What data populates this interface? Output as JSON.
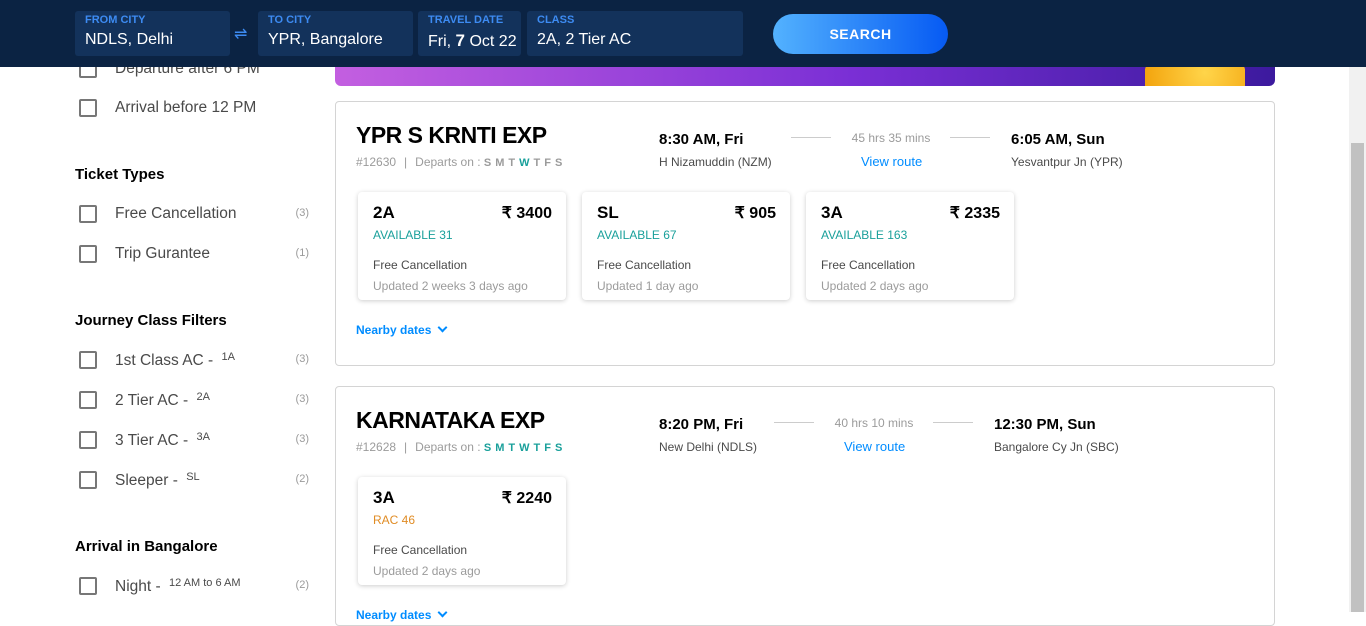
{
  "search": {
    "from": {
      "label": "FROM CITY",
      "value": "NDLS, Delhi"
    },
    "to": {
      "label": "TO CITY",
      "value": "YPR, Bangalore"
    },
    "date": {
      "label": "TRAVEL DATE",
      "prefix": "Fri, ",
      "day": "7",
      "suffix": " Oct 22"
    },
    "class": {
      "label": "CLASS",
      "value": "2A, 2 Tier AC"
    },
    "swap_icon": "⇌",
    "button": "SEARCH"
  },
  "sidebar": {
    "time_filters": [
      {
        "label": "Departure after 6 PM"
      },
      {
        "label": "Arrival before 12 PM"
      }
    ],
    "ticket_types": {
      "title": "Ticket Types",
      "items": [
        {
          "label": "Free Cancellation",
          "count": "(3)"
        },
        {
          "label": "Trip Gurantee",
          "count": "(1)"
        }
      ]
    },
    "journey_class": {
      "title": "Journey Class Filters",
      "items": [
        {
          "label": "1st Class AC - ",
          "sub": "1A",
          "count": "(3)"
        },
        {
          "label": "2 Tier AC - ",
          "sub": "2A",
          "count": "(3)"
        },
        {
          "label": "3 Tier AC - ",
          "sub": "3A",
          "count": "(3)"
        },
        {
          "label": "Sleeper - ",
          "sub": "SL",
          "count": "(2)"
        }
      ]
    },
    "arrival": {
      "title": "Arrival in Bangalore",
      "items": [
        {
          "label": "Night - ",
          "sub": "12 AM to 6 AM",
          "count": "(2)"
        }
      ]
    }
  },
  "trains": [
    {
      "name": "YPR S KRNTI EXP",
      "number": "#12630",
      "departs_label": "Departs on :",
      "days": [
        "S",
        "M",
        "T",
        "W",
        "T",
        "F",
        "S"
      ],
      "days_on": [
        false,
        false,
        false,
        true,
        false,
        false,
        false
      ],
      "dep_time": "8:30 AM, Fri",
      "dep_station": "H Nizamuddin (NZM)",
      "duration": "45 hrs 35 mins",
      "route_link": "View route",
      "arr_time": "6:05 AM, Sun",
      "arr_station": "Yesvantpur Jn (YPR)",
      "fares": [
        {
          "cls": "2A",
          "price": "₹ 3400",
          "avail": "AVAILABLE 31",
          "status": "green",
          "fc": "Free Cancellation",
          "updated": "Updated 2 weeks 3 days ago"
        },
        {
          "cls": "SL",
          "price": "₹ 905",
          "avail": "AVAILABLE 67",
          "status": "green",
          "fc": "Free Cancellation",
          "updated": "Updated 1 day ago"
        },
        {
          "cls": "3A",
          "price": "₹ 2335",
          "avail": "AVAILABLE 163",
          "status": "green",
          "fc": "Free Cancellation",
          "updated": "Updated 2 days ago"
        }
      ],
      "nearby": "Nearby dates"
    },
    {
      "name": "KARNATAKA EXP",
      "number": "#12628",
      "departs_label": "Departs on :",
      "days": [
        "S",
        "M",
        "T",
        "W",
        "T",
        "F",
        "S"
      ],
      "days_on": [
        true,
        true,
        true,
        true,
        true,
        true,
        true
      ],
      "dep_time": "8:20 PM, Fri",
      "dep_station": "New Delhi (NDLS)",
      "duration": "40 hrs 10 mins",
      "route_link": "View route",
      "arr_time": "12:30 PM, Sun",
      "arr_station": "Bangalore Cy Jn (SBC)",
      "fares": [
        {
          "cls": "3A",
          "price": "₹ 2240",
          "avail": "RAC 46",
          "status": "orange",
          "fc": "Free Cancellation",
          "updated": "Updated 2 days ago"
        }
      ],
      "nearby": "Nearby dates"
    }
  ],
  "colors": {
    "header_bg": "#0b2343",
    "accent": "#008cff",
    "available": "#1aa09b",
    "rac": "#e08c25"
  }
}
